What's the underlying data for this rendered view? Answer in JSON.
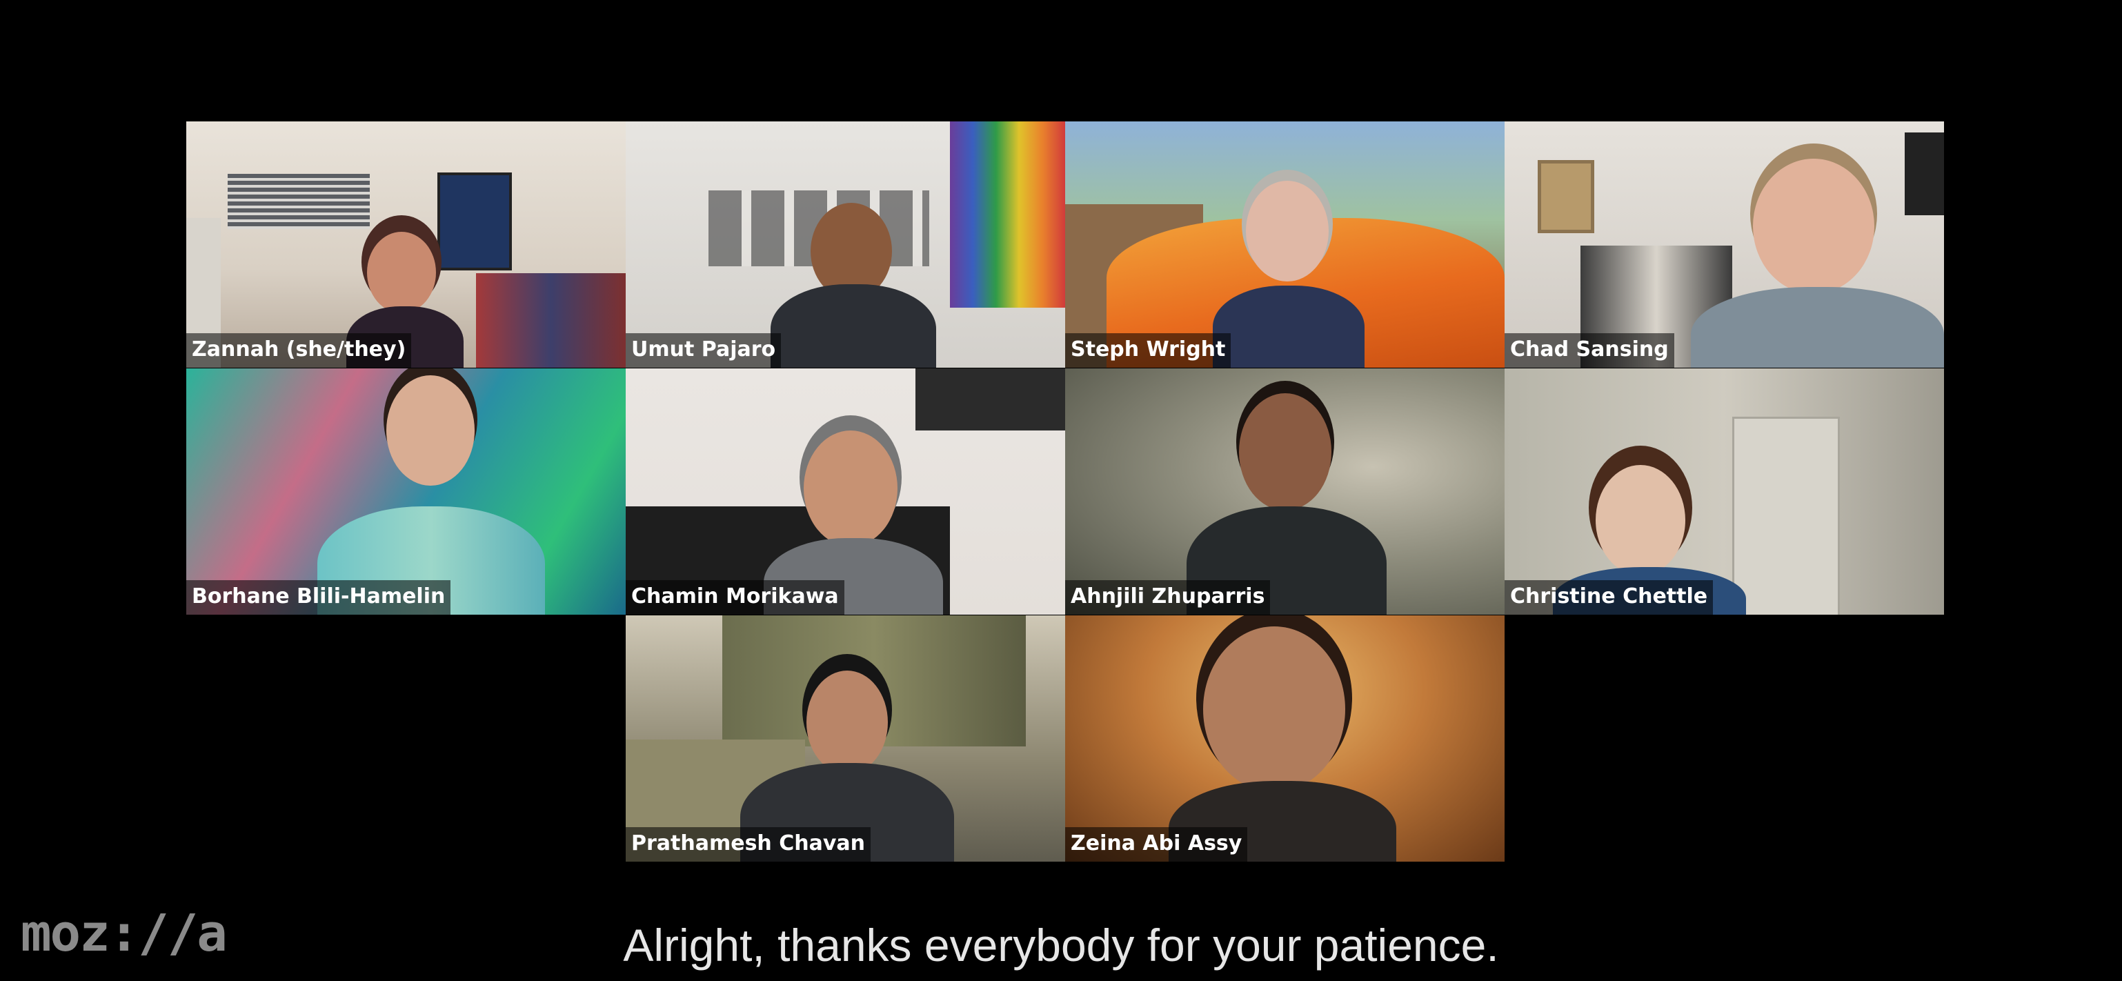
{
  "participants": [
    {
      "name": "Zannah (she/they)"
    },
    {
      "name": "Umut Pajaro"
    },
    {
      "name": "Steph Wright"
    },
    {
      "name": "Chad Sansing"
    },
    {
      "name": "Borhane Blili-Hamelin"
    },
    {
      "name": "Chamin Morikawa"
    },
    {
      "name": "Ahnjili Zhuparris"
    },
    {
      "name": "Christine Chettle"
    },
    {
      "name": "Prathamesh Chavan"
    },
    {
      "name": "Zeina Abi Assy"
    }
  ],
  "caption": "Alright, thanks everybody for your patience.",
  "logo": "moz://a",
  "colors": {
    "background": "#000000",
    "caption_text": "#e6e6e6",
    "logo": "#8a8a8a"
  }
}
